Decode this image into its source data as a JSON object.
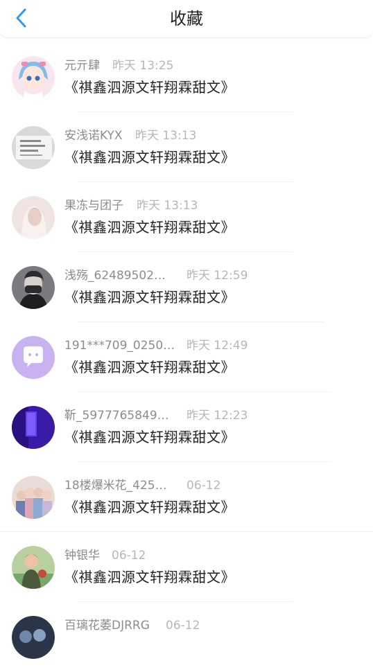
{
  "header": {
    "title": "收藏"
  },
  "items": [
    {
      "name": "元亓肆",
      "time": "昨天 13:25",
      "message": "《祺鑫泗源文轩翔霖甜文》",
      "avatar_colors": [
        "#f7e6ef",
        "#7fbde8"
      ]
    },
    {
      "name": "安浅诺KYX",
      "time": "昨天 13:13",
      "message": "《祺鑫泗源文轩翔霖甜文》",
      "avatar_colors": [
        "#d9d9d9",
        "#f4f4f4"
      ]
    },
    {
      "name": "果冻与团子",
      "time": "昨天 13:13",
      "message": "《祺鑫泗源文轩翔霖甜文》",
      "avatar_colors": [
        "#efe4e2",
        "#c9b3ad"
      ]
    },
    {
      "name": "浅殇_62489502…",
      "time": "昨天 12:59",
      "message": "《祺鑫泗源文轩翔霖甜文》",
      "avatar_colors": [
        "#2b2b2d",
        "#7a7a80"
      ]
    },
    {
      "name": "191***709_0250…",
      "time": "昨天 12:49",
      "message": "《祺鑫泗源文轩翔霖甜文》",
      "avatar_colors": [
        "#c9b2f0",
        "#ffffff"
      ]
    },
    {
      "name": "靳_5977765849…",
      "time": "昨天 12:23",
      "message": "《祺鑫泗源文轩翔霖甜文》",
      "avatar_colors": [
        "#3b1aa8",
        "#6a3ff0"
      ]
    },
    {
      "name": "18楼爆米花_425…",
      "time": "06-12",
      "message": "《祺鑫泗源文轩翔霖甜文》",
      "avatar_colors": [
        "#e9dcd6",
        "#6a7fb0"
      ]
    },
    {
      "name": "钟银华",
      "time": "06-12",
      "message": "《祺鑫泗源文轩翔霖甜文》",
      "avatar_colors": [
        "#77a86a",
        "#c44a3c"
      ]
    },
    {
      "name": "百璃花萎DJRRG",
      "time": "06-12",
      "message": "",
      "avatar_colors": [
        "#2a3548",
        "#6e87a8"
      ]
    }
  ],
  "colors": {
    "accent": "#2d9cf0"
  }
}
